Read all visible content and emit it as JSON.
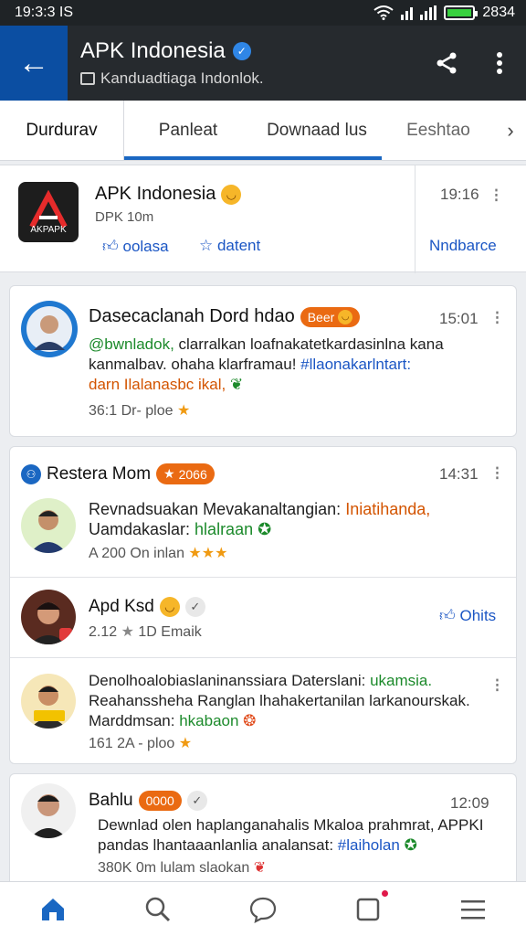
{
  "status": {
    "time": "19:3:3 IS",
    "battery": "2834"
  },
  "appbar": {
    "title": "APK Indonesia",
    "subtitle": "Kanduadtiaga Indonlok."
  },
  "tabs": [
    "Durdurav",
    "Panleat",
    "Downaad lus",
    "Eeshtao",
    "›"
  ],
  "app_card": {
    "name": "APK Indonesia",
    "meta": "DPK 10m",
    "btn1": "oolasa",
    "btn2": "datent",
    "time": "19:16",
    "action": "Nndbarce"
  },
  "post1": {
    "name": "Dasecaclanah Dord hdao",
    "badge": "Beer",
    "time": "15:01",
    "line1_a": "@bwnladok, ",
    "line1_b": "clarralkan loafnakatetkardasinlna kana",
    "line2_a": "kanmalbav. ohaha klarframau! ",
    "line2_b": "#llaonakarlntart:",
    "line3": "darn Ilalanasbc ikal,",
    "meta": "36:1 Dr- ploe"
  },
  "group": {
    "title": "Restera Mom",
    "badge": "2066",
    "time": "14:31",
    "post_a": {
      "line1": "Revnadsuakan Mevakanaltangian: ",
      "line1_hl": "Iniatihanda,",
      "line2": "Uamdakaslar: ",
      "line2_hl": "hlalraan",
      "meta": "A 200 On inlan"
    },
    "post_b": {
      "name": "Apd Ksd",
      "meta1": "2.12",
      "meta2": "1D Emaik",
      "action": "Ohits"
    },
    "post_c": {
      "line1": "Denolhoalobiaslaninanssiara Daterslani: ",
      "line1_hl": "ukamsia.",
      "line2": "Reahanssheha Ranglan lhahakertanilan larkanourskak.",
      "line3": "Marddmsan: ",
      "line3_hl": "hkabaon",
      "meta": "161 2A - ploo"
    }
  },
  "post2": {
    "name": "Bahlu",
    "badge": "0000",
    "time": "12:09",
    "line1": "Dewnlad olen haplanganahalis Mkaloa prahmrat, APPKI",
    "line2": "pandas lhantaaanlanlia analansat: ",
    "line2_hl": "#laiholan",
    "meta": "380K 0m lulam slaokan"
  },
  "colors": {
    "accent": "#1a67c2",
    "badge": "#ea6a12",
    "appbar": "#262a2e"
  }
}
